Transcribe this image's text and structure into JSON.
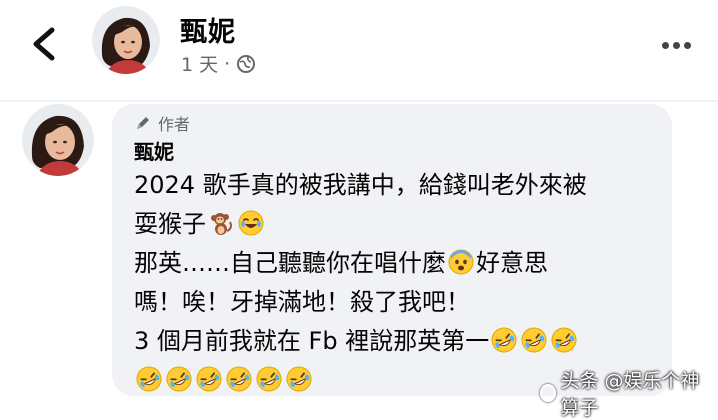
{
  "post_header": {
    "name": "甄妮",
    "time": "1 天",
    "separator": "·"
  },
  "comment": {
    "author_badge": "作者",
    "name": "甄妮",
    "lines": [
      {
        "parts": [
          "2024 歌手真的被我講中，給錢叫老外來被"
        ]
      },
      {
        "parts": [
          "耍猴子",
          "[monkey-emoji]",
          "[joy-emoji]"
        ]
      },
      {
        "parts": [
          "那英……自己聽聽你在唱什麼",
          "[fearful-emoji]",
          "好意思"
        ]
      },
      {
        "parts": [
          "嗎！唉！牙掉滿地！殺了我吧！"
        ]
      },
      {
        "parts": [
          "3 個月前我就在 Fb 裡說那英第一",
          "[rofl-emoji]",
          "[rofl-emoji]",
          "[rofl-emoji]"
        ]
      },
      {
        "parts": [
          "[rofl-emoji]",
          "[rofl-emoji]",
          "[rofl-emoji]",
          "[rofl-emoji]",
          "[rofl-emoji]",
          "[rofl-emoji]"
        ]
      }
    ]
  },
  "watermark": {
    "text": "头条 @娱乐个神算子"
  },
  "icons": {
    "back": "chevron-left-icon",
    "more": "more-dots-icon",
    "globe": "globe-icon",
    "author_badge": "pen-icon"
  },
  "colors": {
    "bubble": "#f0f2f5",
    "meta_text": "#65676b",
    "text": "#050505"
  }
}
